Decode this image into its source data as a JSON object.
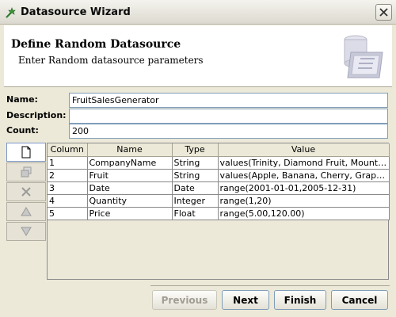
{
  "window": {
    "title": "Datasource Wizard",
    "close_icon": "close-icon"
  },
  "header": {
    "title": "Define Random Datasource",
    "subtitle": "Enter Random datasource parameters"
  },
  "form": {
    "name_label": "Name:",
    "name_value": "FruitSalesGenerator",
    "description_label": "Description:",
    "description_value": "",
    "count_label": "Count:",
    "count_value": "200"
  },
  "toolbar": {
    "buttons": [
      "new-icon",
      "copy-icon",
      "delete-icon",
      "move-up-icon",
      "move-down-icon"
    ]
  },
  "table": {
    "columns": [
      "Column",
      "Name",
      "Type",
      "Value"
    ],
    "rows": [
      [
        "1",
        "CompanyName",
        "String",
        "values(Trinity, Diamond Fruit, Mountain"
      ],
      [
        "2",
        "Fruit",
        "String",
        "values(Apple, Banana, Cherry, Grape, Orange"
      ],
      [
        "3",
        "Date",
        "Date",
        "range(2001-01-01,2005-12-31)"
      ],
      [
        "4",
        "Quantity",
        "Integer",
        "range(1,20)"
      ],
      [
        "5",
        "Price",
        "Float",
        "range(5.00,120.00)"
      ]
    ]
  },
  "buttons": {
    "previous": "Previous",
    "next": "Next",
    "finish": "Finish",
    "cancel": "Cancel"
  }
}
